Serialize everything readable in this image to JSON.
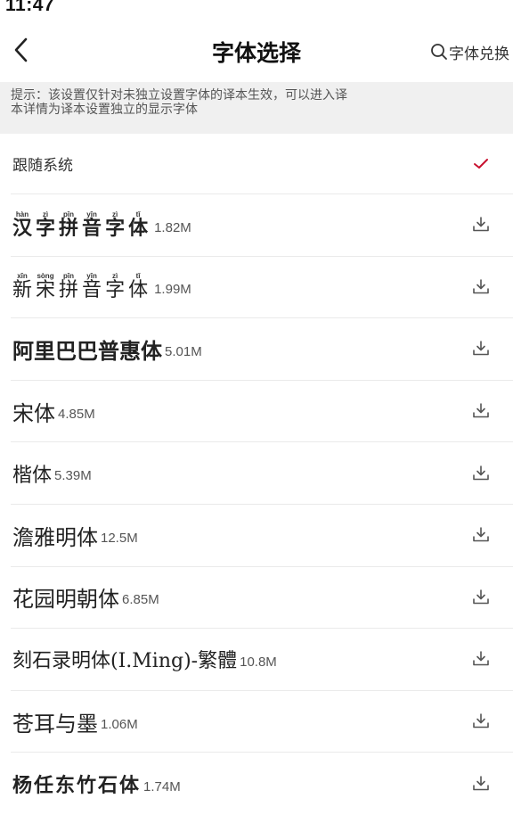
{
  "status_bar": {
    "time": "11:47"
  },
  "nav": {
    "title": "字体选择",
    "redeem_label": "字体兑换"
  },
  "tip": {
    "line1": "提示：该设置仅针对未独立设置字体的译本生效，可以进入译",
    "line2": "本详情为译本设置独立的显示字体"
  },
  "colors": {
    "accent": "#c8102e",
    "tip_background": "#f0f0f0",
    "divider": "#eaeaea"
  },
  "font_list": {
    "system": {
      "label": "跟随系统",
      "selected": true,
      "icon": "checkmark-icon"
    },
    "fonts": [
      {
        "name": "汉字拼音字体",
        "size": "1.82M",
        "pinyin": [
          "hàn",
          "zì",
          "pīn",
          "yīn",
          "zì",
          "tǐ"
        ],
        "chars": [
          "汉",
          "字",
          "拼",
          "音",
          "字",
          "体"
        ],
        "icon": "download-icon"
      },
      {
        "name": "新宋拼音字体",
        "size": "1.99M",
        "pinyin": [
          "xīn",
          "sòng",
          "pīn",
          "yīn",
          "zì",
          "tǐ"
        ],
        "chars": [
          "新",
          "宋",
          "拼",
          "音",
          "字",
          "体"
        ],
        "icon": "download-icon"
      },
      {
        "name": "阿里巴巴普惠体",
        "size": "5.01M",
        "icon": "download-icon"
      },
      {
        "name": "宋体",
        "size": "4.85M",
        "icon": "download-icon"
      },
      {
        "name": "楷体",
        "size": "5.39M",
        "icon": "download-icon"
      },
      {
        "name": "澹雅明体",
        "size": "12.5M",
        "icon": "download-icon"
      },
      {
        "name": "花园明朝体",
        "size": "6.85M",
        "icon": "download-icon"
      },
      {
        "name": "刻石录明体(I.Ming)-繁體",
        "size": "10.8M",
        "icon": "download-icon"
      },
      {
        "name": "苍耳与墨",
        "size": "1.06M",
        "icon": "download-icon"
      },
      {
        "name": "杨任东竹石体",
        "size": "1.74M",
        "icon": "download-icon"
      }
    ]
  }
}
